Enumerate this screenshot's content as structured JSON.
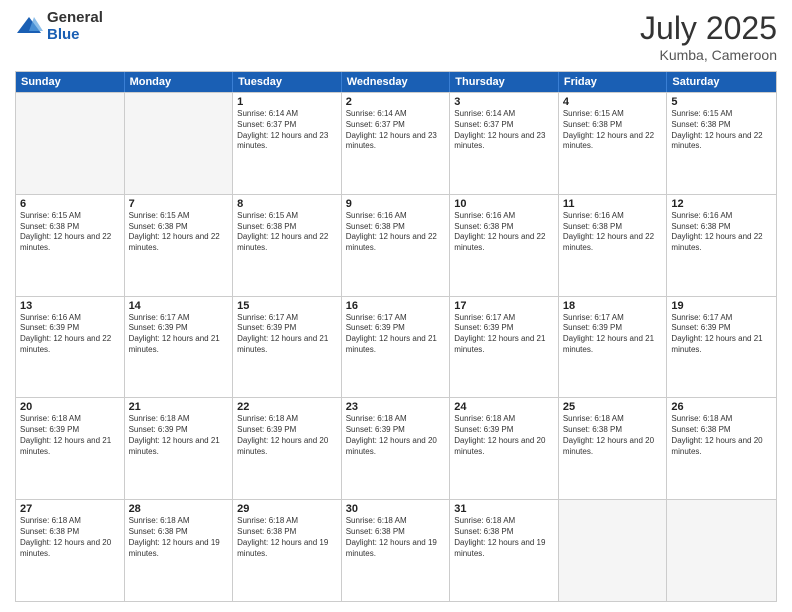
{
  "logo": {
    "general": "General",
    "blue": "Blue"
  },
  "title": "July 2025",
  "location": "Kumba, Cameroon",
  "weekdays": [
    "Sunday",
    "Monday",
    "Tuesday",
    "Wednesday",
    "Thursday",
    "Friday",
    "Saturday"
  ],
  "rows": [
    [
      {
        "day": "",
        "info": "",
        "empty": true
      },
      {
        "day": "",
        "info": "",
        "empty": true
      },
      {
        "day": "1",
        "info": "Sunrise: 6:14 AM\nSunset: 6:37 PM\nDaylight: 12 hours and 23 minutes."
      },
      {
        "day": "2",
        "info": "Sunrise: 6:14 AM\nSunset: 6:37 PM\nDaylight: 12 hours and 23 minutes."
      },
      {
        "day": "3",
        "info": "Sunrise: 6:14 AM\nSunset: 6:37 PM\nDaylight: 12 hours and 23 minutes."
      },
      {
        "day": "4",
        "info": "Sunrise: 6:15 AM\nSunset: 6:38 PM\nDaylight: 12 hours and 22 minutes."
      },
      {
        "day": "5",
        "info": "Sunrise: 6:15 AM\nSunset: 6:38 PM\nDaylight: 12 hours and 22 minutes."
      }
    ],
    [
      {
        "day": "6",
        "info": "Sunrise: 6:15 AM\nSunset: 6:38 PM\nDaylight: 12 hours and 22 minutes."
      },
      {
        "day": "7",
        "info": "Sunrise: 6:15 AM\nSunset: 6:38 PM\nDaylight: 12 hours and 22 minutes."
      },
      {
        "day": "8",
        "info": "Sunrise: 6:15 AM\nSunset: 6:38 PM\nDaylight: 12 hours and 22 minutes."
      },
      {
        "day": "9",
        "info": "Sunrise: 6:16 AM\nSunset: 6:38 PM\nDaylight: 12 hours and 22 minutes."
      },
      {
        "day": "10",
        "info": "Sunrise: 6:16 AM\nSunset: 6:38 PM\nDaylight: 12 hours and 22 minutes."
      },
      {
        "day": "11",
        "info": "Sunrise: 6:16 AM\nSunset: 6:38 PM\nDaylight: 12 hours and 22 minutes."
      },
      {
        "day": "12",
        "info": "Sunrise: 6:16 AM\nSunset: 6:38 PM\nDaylight: 12 hours and 22 minutes."
      }
    ],
    [
      {
        "day": "13",
        "info": "Sunrise: 6:16 AM\nSunset: 6:39 PM\nDaylight: 12 hours and 22 minutes."
      },
      {
        "day": "14",
        "info": "Sunrise: 6:17 AM\nSunset: 6:39 PM\nDaylight: 12 hours and 21 minutes."
      },
      {
        "day": "15",
        "info": "Sunrise: 6:17 AM\nSunset: 6:39 PM\nDaylight: 12 hours and 21 minutes."
      },
      {
        "day": "16",
        "info": "Sunrise: 6:17 AM\nSunset: 6:39 PM\nDaylight: 12 hours and 21 minutes."
      },
      {
        "day": "17",
        "info": "Sunrise: 6:17 AM\nSunset: 6:39 PM\nDaylight: 12 hours and 21 minutes."
      },
      {
        "day": "18",
        "info": "Sunrise: 6:17 AM\nSunset: 6:39 PM\nDaylight: 12 hours and 21 minutes."
      },
      {
        "day": "19",
        "info": "Sunrise: 6:17 AM\nSunset: 6:39 PM\nDaylight: 12 hours and 21 minutes."
      }
    ],
    [
      {
        "day": "20",
        "info": "Sunrise: 6:18 AM\nSunset: 6:39 PM\nDaylight: 12 hours and 21 minutes."
      },
      {
        "day": "21",
        "info": "Sunrise: 6:18 AM\nSunset: 6:39 PM\nDaylight: 12 hours and 21 minutes."
      },
      {
        "day": "22",
        "info": "Sunrise: 6:18 AM\nSunset: 6:39 PM\nDaylight: 12 hours and 20 minutes."
      },
      {
        "day": "23",
        "info": "Sunrise: 6:18 AM\nSunset: 6:39 PM\nDaylight: 12 hours and 20 minutes."
      },
      {
        "day": "24",
        "info": "Sunrise: 6:18 AM\nSunset: 6:39 PM\nDaylight: 12 hours and 20 minutes."
      },
      {
        "day": "25",
        "info": "Sunrise: 6:18 AM\nSunset: 6:38 PM\nDaylight: 12 hours and 20 minutes."
      },
      {
        "day": "26",
        "info": "Sunrise: 6:18 AM\nSunset: 6:38 PM\nDaylight: 12 hours and 20 minutes."
      }
    ],
    [
      {
        "day": "27",
        "info": "Sunrise: 6:18 AM\nSunset: 6:38 PM\nDaylight: 12 hours and 20 minutes."
      },
      {
        "day": "28",
        "info": "Sunrise: 6:18 AM\nSunset: 6:38 PM\nDaylight: 12 hours and 19 minutes."
      },
      {
        "day": "29",
        "info": "Sunrise: 6:18 AM\nSunset: 6:38 PM\nDaylight: 12 hours and 19 minutes."
      },
      {
        "day": "30",
        "info": "Sunrise: 6:18 AM\nSunset: 6:38 PM\nDaylight: 12 hours and 19 minutes."
      },
      {
        "day": "31",
        "info": "Sunrise: 6:18 AM\nSunset: 6:38 PM\nDaylight: 12 hours and 19 minutes."
      },
      {
        "day": "",
        "info": "",
        "empty": true
      },
      {
        "day": "",
        "info": "",
        "empty": true
      }
    ]
  ]
}
